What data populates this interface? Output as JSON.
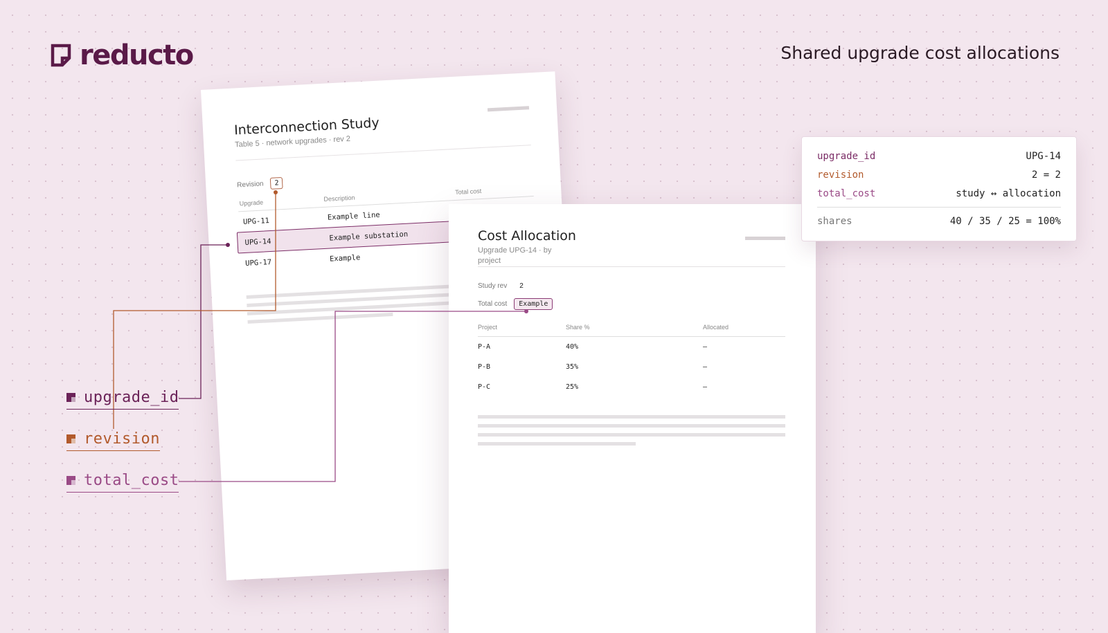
{
  "brand": {
    "name": "reducto"
  },
  "header": {
    "title": "Shared upgrade cost allocations"
  },
  "study_doc": {
    "title": "Interconnection Study",
    "subtitle": "Table 5 · network upgrades · rev 2",
    "revision_label": "Revision",
    "revision_value": "2",
    "columns": [
      "Upgrade",
      "Description",
      "Total cost"
    ],
    "rows": [
      {
        "upgrade": "UPG-11",
        "description": "Example line",
        "cost": "—"
      },
      {
        "upgrade": "UPG-14",
        "description": "Example substation",
        "cost": "—"
      },
      {
        "upgrade": "UPG-17",
        "description": "Example",
        "cost": "—"
      }
    ]
  },
  "alloc_doc": {
    "title": "Cost Allocation",
    "subtitle": "Upgrade UPG-14 · by project",
    "study_rev_label": "Study rev",
    "study_rev_value": "2",
    "total_cost_label": "Total cost",
    "total_cost_value": "Example",
    "columns": [
      "Project",
      "Share %",
      "Allocated"
    ],
    "rows": [
      {
        "project": "P-A",
        "share": "40%",
        "allocated": "—"
      },
      {
        "project": "P-B",
        "share": "35%",
        "allocated": "—"
      },
      {
        "project": "P-C",
        "share": "25%",
        "allocated": "—"
      }
    ]
  },
  "legend": {
    "items": [
      {
        "label": "upgrade_id",
        "color": "#6b2258"
      },
      {
        "label": "revision",
        "color": "#b25a2c"
      },
      {
        "label": "total_cost",
        "color": "#9a4a86"
      }
    ]
  },
  "summary": {
    "rows": [
      {
        "key": "upgrade_id",
        "value": "UPG-14",
        "color": "#7b2c66"
      },
      {
        "key": "revision",
        "value": "2 = 2",
        "color": "#b25a2c"
      },
      {
        "key": "total_cost",
        "value": "study ↔ allocation",
        "color": "#9a4a86"
      },
      {
        "key": "shares",
        "value": "40 / 35 / 25 = 100%",
        "color": "#777777"
      }
    ]
  },
  "colors": {
    "background": "#f3e6ee",
    "brand": "#5a1a48",
    "upgrade_id": "#6b2258",
    "revision": "#b25a2c",
    "total_cost": "#9a4a86"
  }
}
